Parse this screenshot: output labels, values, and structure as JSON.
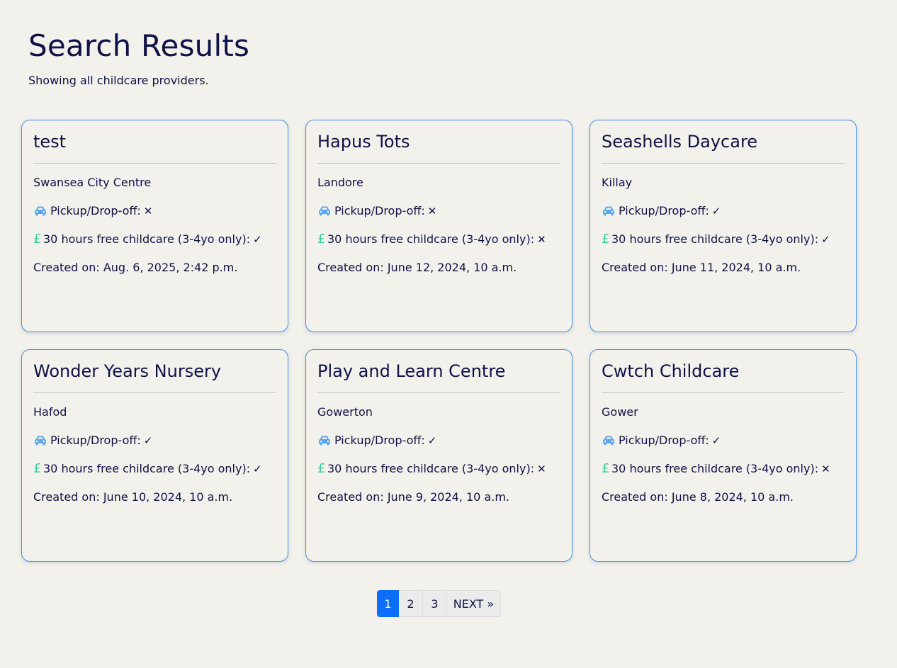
{
  "header": {
    "title": "Search Results",
    "subtitle": "Showing all childcare providers."
  },
  "labels": {
    "pickup": "Pickup/Drop-off:",
    "free_hours": "30 hours free childcare (3-4yo only):",
    "created_prefix": "Created on: "
  },
  "icons": {
    "car": "car-icon",
    "pound": "pound-icon",
    "yes": "check-icon",
    "no": "cross-icon"
  },
  "colors": {
    "accent": "#0d6efd",
    "car_icon": "#5aa6f0",
    "pound_icon": "#3ccf9e",
    "card_border": "#4a90e2",
    "text": "#0f1147"
  },
  "providers": [
    {
      "name": "test",
      "location": "Swansea City Centre",
      "pickup": false,
      "free_hours": true,
      "created": "Aug. 6, 2025, 2:42 p.m."
    },
    {
      "name": "Hapus Tots",
      "location": "Landore",
      "pickup": false,
      "free_hours": false,
      "created": "June 12, 2024, 10 a.m."
    },
    {
      "name": "Seashells Daycare",
      "location": "Killay",
      "pickup": true,
      "free_hours": true,
      "created": "June 11, 2024, 10 a.m."
    },
    {
      "name": "Wonder Years Nursery",
      "location": "Hafod",
      "pickup": true,
      "free_hours": true,
      "created": "June 10, 2024, 10 a.m."
    },
    {
      "name": "Play and Learn Centre",
      "location": "Gowerton",
      "pickup": true,
      "free_hours": false,
      "created": "June 9, 2024, 10 a.m."
    },
    {
      "name": "Cwtch Childcare",
      "location": "Gower",
      "pickup": true,
      "free_hours": false,
      "created": "June 8, 2024, 10 a.m."
    }
  ],
  "pagination": {
    "pages": [
      "1",
      "2",
      "3"
    ],
    "current": "1",
    "next_label": "NEXT »"
  }
}
